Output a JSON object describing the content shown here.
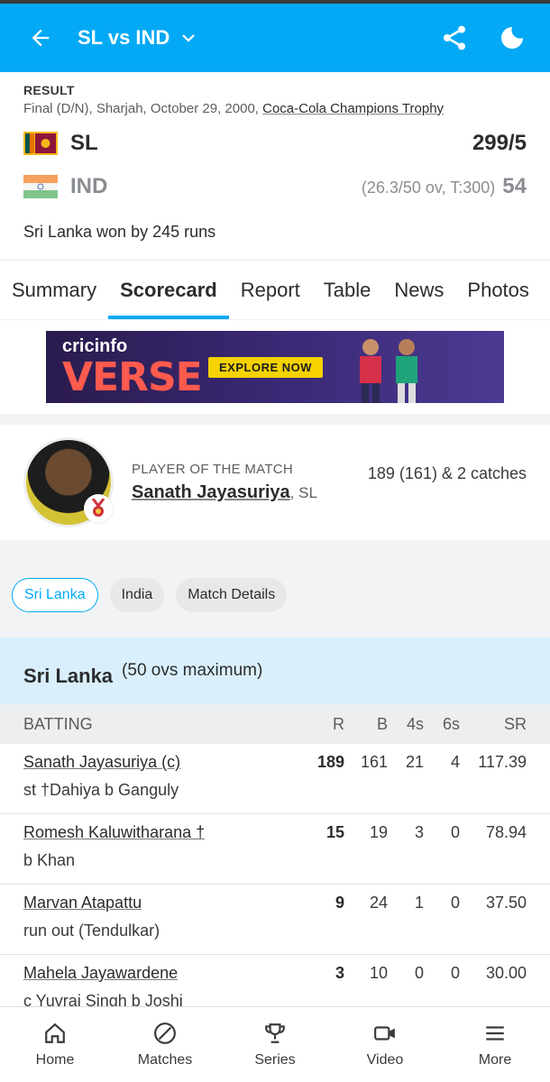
{
  "appbar": {
    "title": "SL vs IND",
    "back_icon": "arrow-left-icon",
    "share_icon": "share-icon",
    "theme_icon": "moon-icon",
    "accent_color": "#03a9f4"
  },
  "match": {
    "status": "RESULT",
    "info_prefix": "Final (D/N), Sharjah, October 29, 2000, ",
    "series": "Coca-Cola Champions Trophy",
    "teams": [
      {
        "abbr": "SL",
        "score": "299/5",
        "meta": ""
      },
      {
        "abbr": "IND",
        "score": "54",
        "meta": "(26.3/50 ov, T:300)"
      }
    ],
    "result": "Sri Lanka won by 245 runs"
  },
  "tabs": [
    "Summary",
    "Scorecard",
    "Report",
    "Table",
    "News",
    "Photos"
  ],
  "ad": {
    "brand": "cricinfo",
    "word": "VERSE",
    "cta": "EXPLORE NOW"
  },
  "potm": {
    "label": "PLAYER OF THE MATCH",
    "name": "Sanath Jayasuriya",
    "team": ", SL",
    "stat": "189 (161) & 2 catches"
  },
  "chips": [
    "Sri Lanka",
    "India",
    "Match Details"
  ],
  "innings": {
    "team": "Sri Lanka",
    "sub": "(50 ovs maximum)",
    "headers": {
      "name": "BATTING",
      "r": "R",
      "b": "B",
      "fours": "4s",
      "sixes": "6s",
      "sr": "SR"
    },
    "batters": [
      {
        "name": "Sanath Jayasuriya (c)",
        "dismissal": "st †Dahiya b Ganguly",
        "r": "189",
        "b": "161",
        "fours": "21",
        "sixes": "4",
        "sr": "117.39"
      },
      {
        "name": "Romesh Kaluwitharana †",
        "dismissal": "b Khan",
        "r": "15",
        "b": "19",
        "fours": "3",
        "sixes": "0",
        "sr": "78.94"
      },
      {
        "name": "Marvan Atapattu",
        "dismissal": "run out (Tendulkar)",
        "r": "9",
        "b": "24",
        "fours": "1",
        "sixes": "0",
        "sr": "37.50"
      },
      {
        "name": "Mahela Jayawardene",
        "dismissal": "c Yuvraj Singh b Joshi",
        "r": "3",
        "b": "10",
        "fours": "0",
        "sixes": "0",
        "sr": "30.00"
      }
    ]
  },
  "bottomnav": [
    {
      "label": "Home",
      "icon": "home-icon"
    },
    {
      "label": "Matches",
      "icon": "matches-icon"
    },
    {
      "label": "Series",
      "icon": "trophy-icon"
    },
    {
      "label": "Video",
      "icon": "video-icon"
    },
    {
      "label": "More",
      "icon": "menu-icon"
    }
  ]
}
